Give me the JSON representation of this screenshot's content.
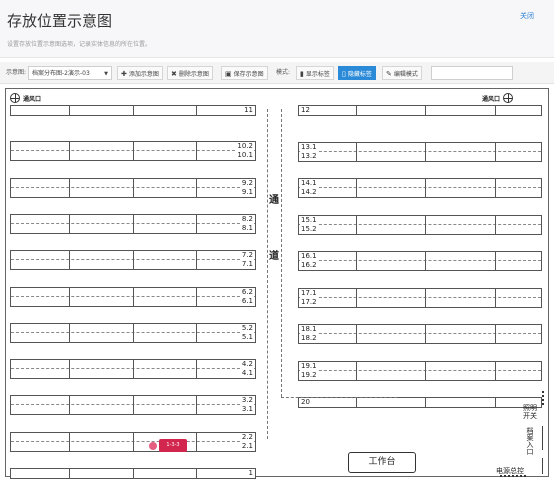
{
  "header": {
    "title": "存放位置示意图",
    "description": "设置存放位置示意图选项，记录实体信息的所在位置。",
    "close_label": "关闭"
  },
  "toolbar": {
    "diagram_label": "示意图:",
    "diagram_select": "档案分布图-2演示-03",
    "add_label": "添加示意图",
    "delete_label": "删除示意图",
    "save_label": "保存示意图",
    "mode_label": "模式:",
    "show_tags_label": "显示标签",
    "hide_tags_label": "隐藏标签",
    "edit_mode_label": "编辑模式",
    "search_value": ""
  },
  "map": {
    "vent_left": "通风口",
    "vent_right": "通风口",
    "aisle_chars": [
      "通",
      "道"
    ],
    "left_shelves": [
      [
        "11"
      ],
      [
        "10.2",
        "10.1"
      ],
      [
        "9.2",
        "9.1"
      ],
      [
        "8.2",
        "8.1"
      ],
      [
        "7.2",
        "7.1"
      ],
      [
        "6.2",
        "6.1"
      ],
      [
        "5.2",
        "5.1"
      ],
      [
        "4.2",
        "4.1"
      ],
      [
        "3.2",
        "3.1"
      ],
      [
        "2.2",
        "2.1"
      ],
      [
        "1"
      ]
    ],
    "right_shelves": [
      [
        "12"
      ],
      [
        "13.1",
        "13.2"
      ],
      [
        "14.1",
        "14.2"
      ],
      [
        "15.1",
        "15.2"
      ],
      [
        "16.1",
        "16.2"
      ],
      [
        "17.1",
        "17.2"
      ],
      [
        "18.1",
        "18.2"
      ],
      [
        "19.1",
        "19.2"
      ],
      [
        "20"
      ]
    ],
    "marker_tag": "1-3-3",
    "workbench": "工作台",
    "light_switch": [
      "照明",
      "开关"
    ],
    "archive_entrance": "档案入口",
    "power_master": "电源总控"
  },
  "colors": {
    "accent": "#2a8ad8",
    "marker": "#d2264f",
    "link": "#2a7fd4"
  }
}
